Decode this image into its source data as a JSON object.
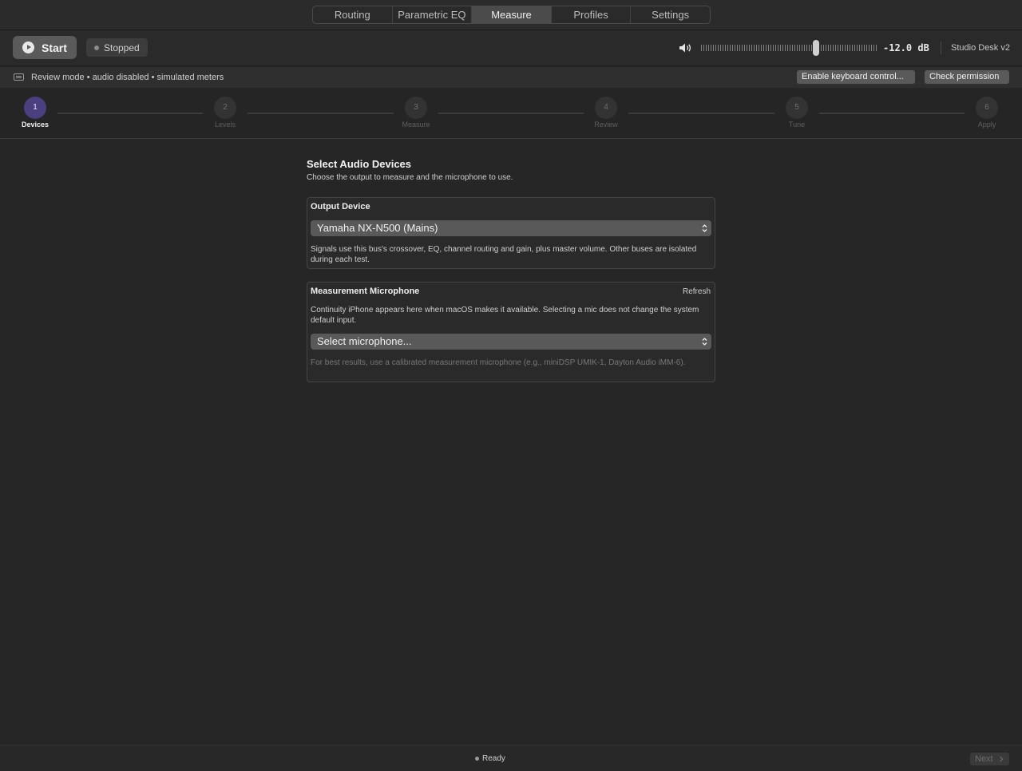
{
  "tabs": [
    "Routing",
    "Parametric EQ",
    "Measure",
    "Profiles",
    "Settings"
  ],
  "active_tab": "Measure",
  "transport": {
    "start_label": "Start",
    "status": "Stopped",
    "volume_readout": "-12.0 dB",
    "volume_level": 0.66,
    "profile_name": "Studio Desk v2"
  },
  "banner": {
    "text": "Review mode • audio disabled • simulated meters",
    "keyboard_button": "Enable keyboard control...",
    "permission_button": "Check permission"
  },
  "steps": [
    {
      "number": "1",
      "label": "Devices",
      "active": true
    },
    {
      "number": "2",
      "label": "Levels",
      "active": false
    },
    {
      "number": "3",
      "label": "Measure",
      "active": false
    },
    {
      "number": "4",
      "label": "Review",
      "active": false
    },
    {
      "number": "5",
      "label": "Tune",
      "active": false
    },
    {
      "number": "6",
      "label": "Apply",
      "active": false
    }
  ],
  "main": {
    "title": "Select Audio Devices",
    "subtitle": "Choose the output to measure and the microphone to use.",
    "output": {
      "label": "Output Device",
      "selected": "Yamaha NX-N500 (Mains)",
      "help": "Signals use this bus's crossover, EQ, channel routing and gain, plus master volume. Other buses are isolated during each test."
    },
    "microphone": {
      "label": "Measurement Microphone",
      "refresh": "Refresh",
      "help": "Continuity iPhone appears here when macOS makes it available. Selecting a mic does not change the system default input.",
      "selected": "Select microphone...",
      "tip": "For best results, use a calibrated measurement microphone (e.g., miniDSP UMIK-1, Dayton Audio iMM-6)."
    }
  },
  "statusbar": {
    "status": "Ready",
    "next_label": "Next"
  }
}
